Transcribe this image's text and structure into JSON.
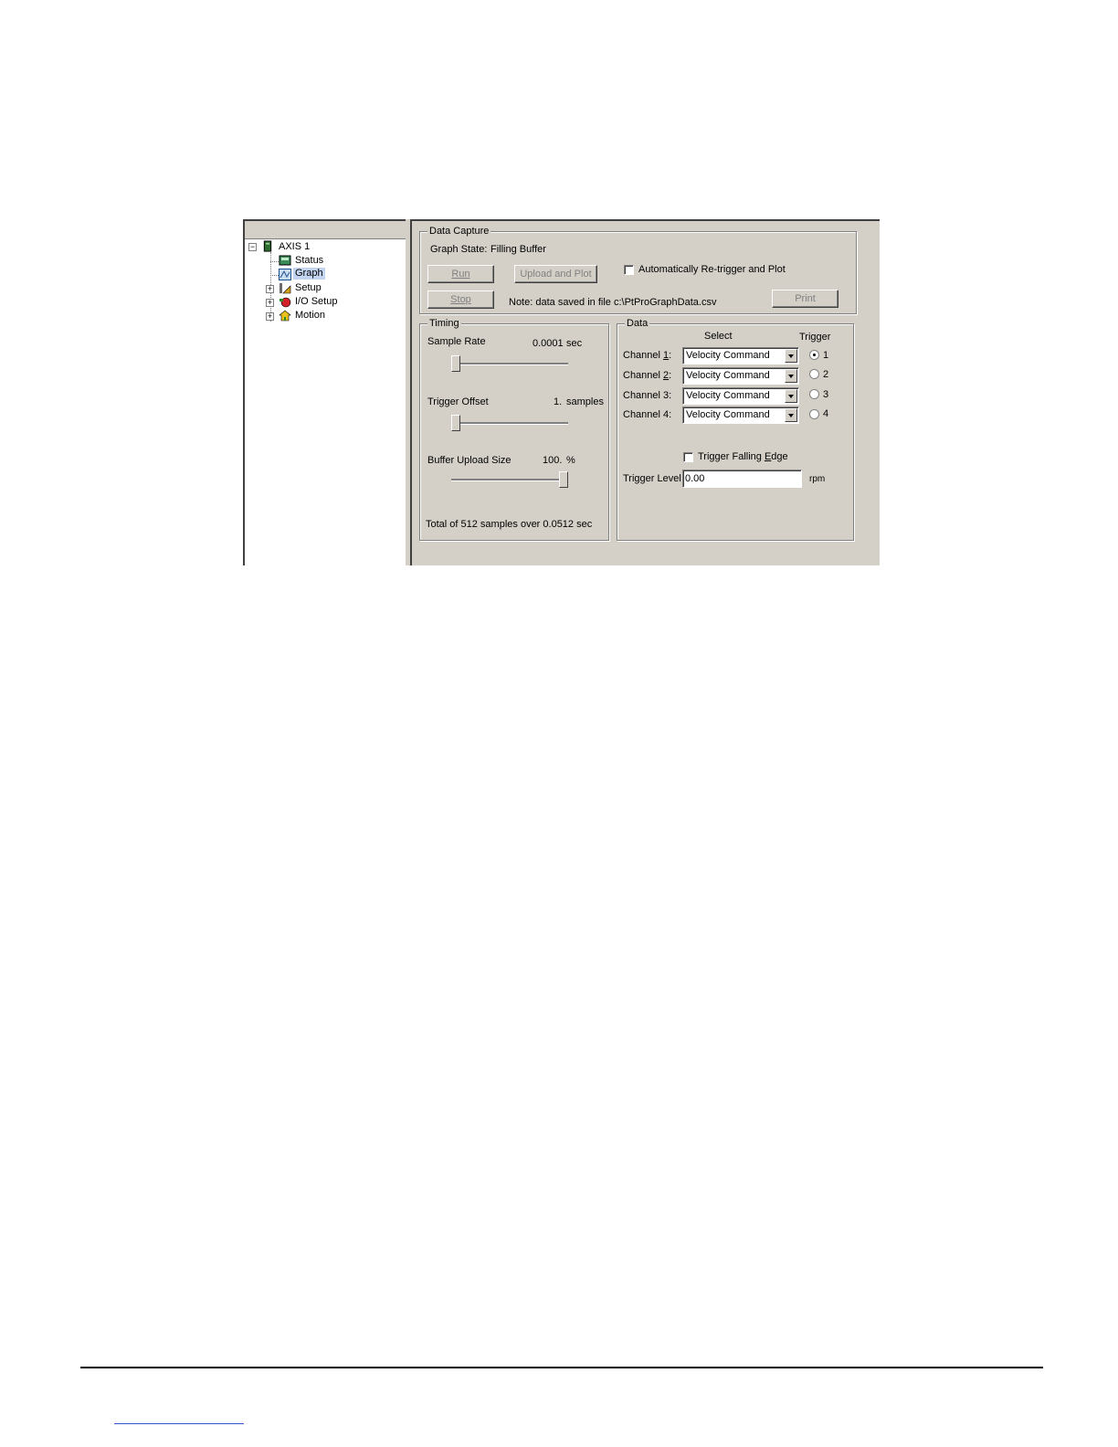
{
  "tree": {
    "root": "AXIS 1",
    "items": [
      {
        "label": "Status",
        "icon": "status-icon"
      },
      {
        "label": "Graph",
        "icon": "graph-icon",
        "selected": true
      },
      {
        "label": "Setup",
        "icon": "setup-icon",
        "expandable": true
      },
      {
        "label": "I/O Setup",
        "icon": "io-setup-icon",
        "expandable": true
      },
      {
        "label": "Motion",
        "icon": "motion-icon",
        "expandable": true
      }
    ]
  },
  "capture": {
    "legend": "Data Capture",
    "graph_state_label": "Graph State:",
    "graph_state_value": "Filling Buffer",
    "run_label": "Run",
    "upload_label": "Upload and Plot",
    "stop_label": "Stop",
    "print_label": "Print",
    "auto_retrigger_label": "Automatically Re-trigger and Plot",
    "auto_retrigger_checked": false,
    "note": "Note: data saved in file c:\\PtProGraphData.csv"
  },
  "timing": {
    "legend": "Timing",
    "sample_rate_label": "Sample Rate",
    "sample_rate_value": "0.0001",
    "sample_rate_unit": "sec",
    "sample_rate_fraction": 0.0,
    "trigger_offset_label": "Trigger Offset",
    "trigger_offset_value": "1.",
    "trigger_offset_unit": "samples",
    "trigger_offset_fraction": 0.0,
    "buffer_label": "Buffer Upload Size",
    "buffer_value": "100.",
    "buffer_unit": "%",
    "buffer_fraction": 1.0,
    "total": "Total of 512 samples over 0.0512 sec"
  },
  "data": {
    "legend": "Data",
    "select_header": "Select",
    "trigger_header": "Trigger",
    "channels": [
      {
        "label_pre": "Channel ",
        "label_key": "1",
        "label_post": ":",
        "select": "Velocity Command",
        "trigger": "1",
        "checked": true
      },
      {
        "label_pre": "Channel ",
        "label_key": "2",
        "label_post": ":",
        "select": "Velocity Command",
        "trigger": "2",
        "checked": false
      },
      {
        "label_pre": "Channel 3:",
        "label_key": "",
        "label_post": "",
        "select": "Velocity Command",
        "trigger": "3",
        "checked": false
      },
      {
        "label_pre": "Channel 4:",
        "label_key": "",
        "label_post": "",
        "select": "Velocity Command",
        "trigger": "4",
        "checked": false
      }
    ],
    "falling_edge_pre": "Trigger Falling ",
    "falling_edge_key": "E",
    "falling_edge_post": "dge",
    "falling_edge_checked": false,
    "trigger_level_label": "Trigger Level",
    "trigger_level_value": "0.00",
    "trigger_level_unit": "rpm"
  }
}
